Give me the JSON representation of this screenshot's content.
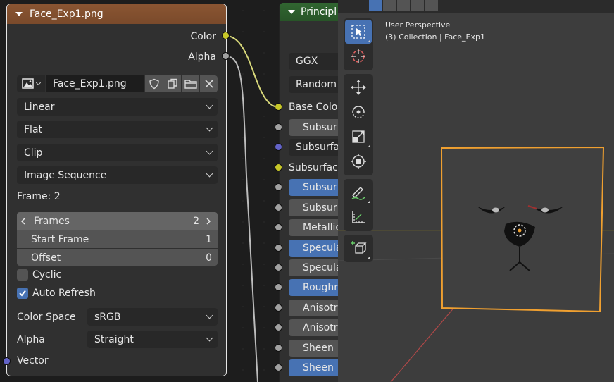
{
  "image_node": {
    "title": "Face_Exp1.png",
    "outputs": [
      "Color",
      "Alpha"
    ],
    "image_name": "Face_Exp1.png",
    "interpolation": "Linear",
    "projection": "Flat",
    "extension": "Clip",
    "source": "Image Sequence",
    "frame_label": "Frame: 2",
    "frames": {
      "label": "Frames",
      "value": "2"
    },
    "start_frame": {
      "label": "Start Frame",
      "value": "1"
    },
    "offset": {
      "label": "Offset",
      "value": "0"
    },
    "cyclic_label": "Cyclic",
    "auto_refresh_label": "Auto Refresh",
    "color_space": {
      "label": "Color Space",
      "value": "sRGB"
    },
    "alpha": {
      "label": "Alpha",
      "value": "Straight"
    },
    "input_vector": "Vector"
  },
  "principled_node": {
    "title": "Principl",
    "distribution": "GGX",
    "subsurface_method": "Random",
    "fields": [
      {
        "label": "Base Color",
        "style": "plain"
      },
      {
        "label": "Subsurf",
        "style": "grey"
      },
      {
        "label": "Subsurfa",
        "style": "dark"
      },
      {
        "label": "Subsurfac",
        "style": "plain"
      },
      {
        "label": "Subsur",
        "style": "blue"
      },
      {
        "label": "Subsur",
        "style": "grey"
      },
      {
        "label": "Metallic",
        "style": "grey"
      },
      {
        "label": "Specula",
        "style": "blue"
      },
      {
        "label": "Specula",
        "style": "grey"
      },
      {
        "label": "Roughn",
        "style": "blue"
      },
      {
        "label": "Anisotr",
        "style": "grey"
      },
      {
        "label": "Anisotr",
        "style": "grey"
      },
      {
        "label": "Sheen",
        "style": "grey"
      },
      {
        "label": "Sheen",
        "style": "blue"
      }
    ]
  },
  "viewport": {
    "view_name": "User Perspective",
    "collection_info": "(3) Collection | Face_Exp1"
  },
  "colors": {
    "accent": "#4772b3",
    "image_node_header": "#7a4a2b",
    "principled_header": "#2b5a2b",
    "selection_outline": "#f0a030",
    "socket_color": "#c7c729",
    "socket_float": "#a1a1a1",
    "socket_vector": "#6363c7"
  }
}
